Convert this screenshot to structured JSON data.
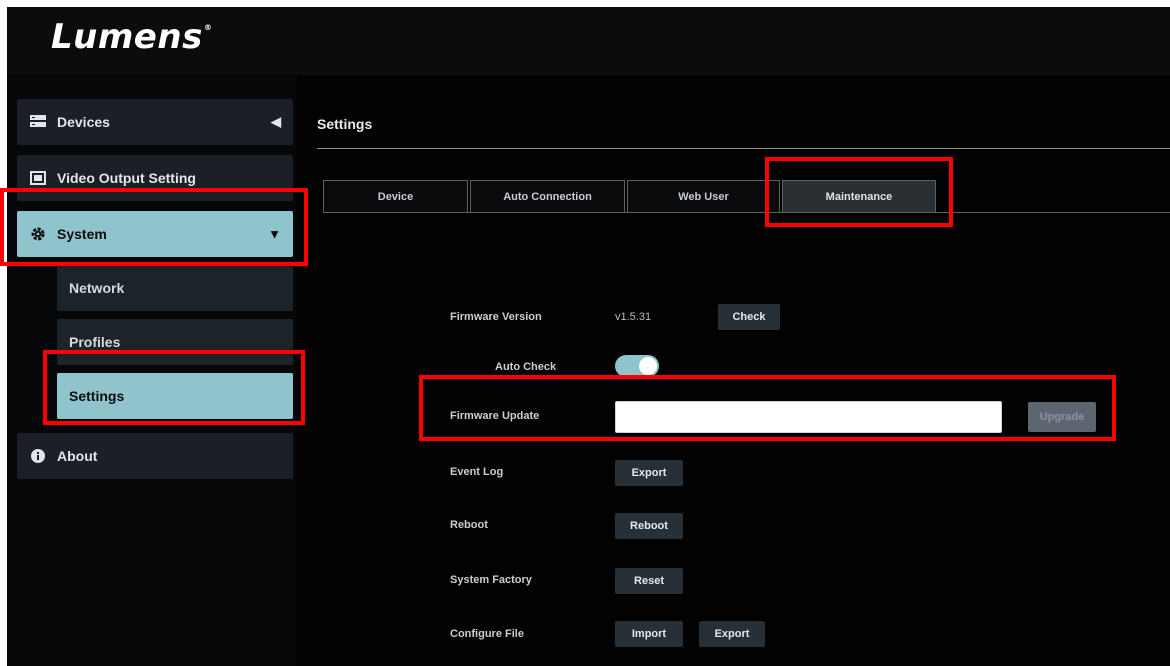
{
  "brand": {
    "logo": "Lumens",
    "trademark": "®"
  },
  "sidebar": {
    "items": [
      {
        "label": "Devices",
        "icon": "devices-icon",
        "caret": "◀"
      },
      {
        "label": "Video Output Setting",
        "icon": "video-output-icon"
      },
      {
        "label": "System",
        "icon": "gear-icon",
        "caret": "▼"
      },
      {
        "label": "About",
        "icon": "info-icon"
      }
    ],
    "subitems": [
      {
        "label": "Network"
      },
      {
        "label": "Profiles"
      },
      {
        "label": "Settings"
      }
    ]
  },
  "main": {
    "title": "Settings",
    "tabs": [
      {
        "label": "Device"
      },
      {
        "label": "Auto Connection"
      },
      {
        "label": "Web User"
      },
      {
        "label": "Maintenance"
      }
    ],
    "firmware_version": {
      "label": "Firmware Version",
      "value": "v1.5.31",
      "button": "Check"
    },
    "auto_check": {
      "label": "Auto Check",
      "state": "on"
    },
    "firmware_update": {
      "label": "Firmware Update",
      "value": "",
      "button": "Upgrade"
    },
    "event_log": {
      "label": "Event Log",
      "button": "Export"
    },
    "reboot": {
      "label": "Reboot",
      "button": "Reboot"
    },
    "system_factory": {
      "label": "System Factory",
      "button": "Reset"
    },
    "configure_file": {
      "label": "Configure File",
      "import_button": "Import",
      "export_button": "Export"
    }
  },
  "colors": {
    "accent": "#8fc4cc",
    "highlight": "#ff0000",
    "background": "#040506"
  }
}
